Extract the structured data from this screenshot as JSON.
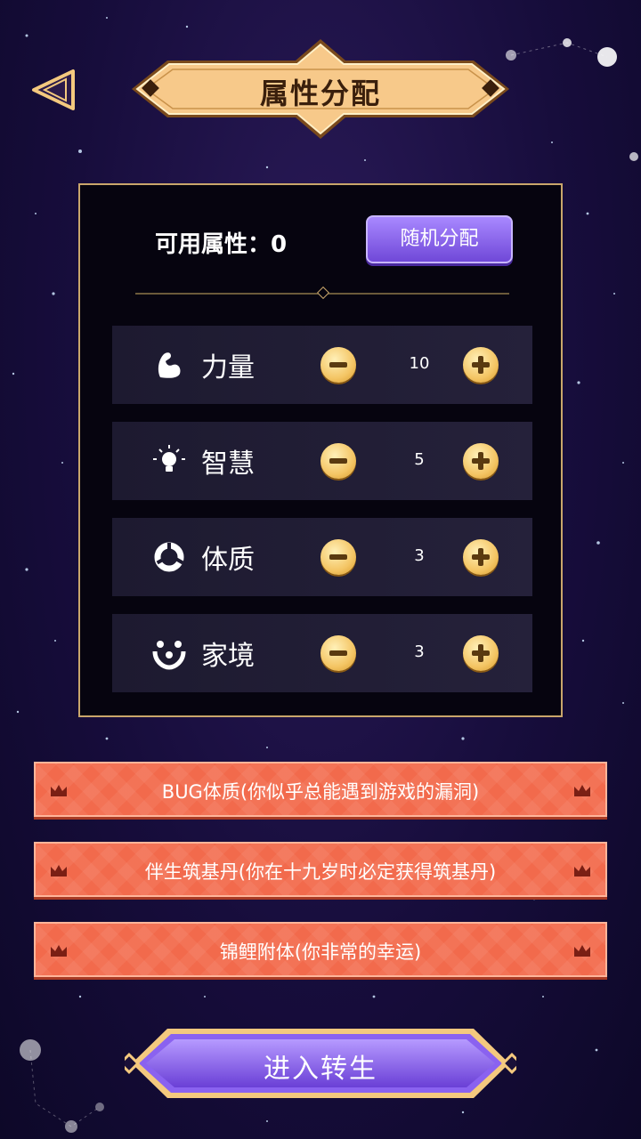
{
  "header": {
    "title": "属性分配",
    "back_icon": "back-arrow-icon"
  },
  "panel": {
    "available_label": "可用属性：0",
    "random_button": "随机分配",
    "attributes": [
      {
        "label": "力量",
        "value": "10",
        "icon": "strength-arm-icon"
      },
      {
        "label": "智慧",
        "value": "5",
        "icon": "lightbulb-icon"
      },
      {
        "label": "体质",
        "value": "3",
        "icon": "health-ring-icon"
      },
      {
        "label": "家境",
        "value": "3",
        "icon": "family-icon"
      }
    ]
  },
  "talents": [
    {
      "text": "BUG体质(你似乎总能遇到游戏的漏洞)"
    },
    {
      "text": "伴生筑基丹(你在十九岁时必定获得筑基丹)"
    },
    {
      "text": "锦鲤附体(你非常的幸运)"
    }
  ],
  "footer": {
    "enter_button": "进入转生"
  },
  "colors": {
    "background": "#170d3c",
    "gold": "#c9a66b",
    "banner": "#f7c98a",
    "purple_button": "#7048d8",
    "talent_red": "#f26a4c"
  }
}
